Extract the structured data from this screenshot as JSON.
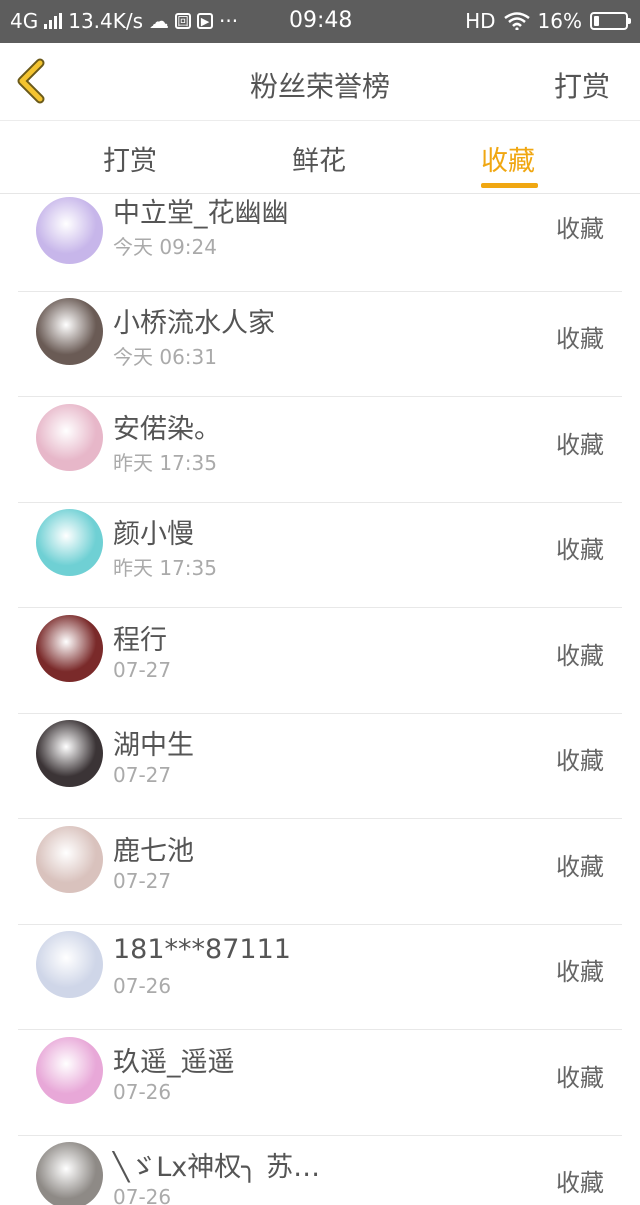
{
  "status_bar": {
    "network": "4G",
    "speed": "13.4K/s",
    "time": "09:48",
    "hd": "HD",
    "battery": "16%",
    "battery_level": 0.16,
    "dots": "···"
  },
  "header": {
    "title": "粉丝荣誉榜",
    "right_link": "打赏"
  },
  "tabs": [
    {
      "label": "打赏",
      "active": false
    },
    {
      "label": "鲜花",
      "active": false
    },
    {
      "label": "收藏",
      "active": true
    }
  ],
  "fans": [
    {
      "name": "中立堂_花幽幽",
      "time": "今天 09:24",
      "action": "收藏",
      "avatar_color": "#c7b6ea"
    },
    {
      "name": "小桥流水人家",
      "time": "今天 06:31",
      "action": "收藏",
      "avatar_color": "#6a5b55"
    },
    {
      "name": "安偌染。",
      "time": "昨天 17:35",
      "action": "收藏",
      "avatar_color": "#e7b7c9"
    },
    {
      "name": "颜小慢",
      "time": "昨天 17:35",
      "action": "收藏",
      "avatar_color": "#6fd0d4"
    },
    {
      "name": "程行",
      "time": "07-27",
      "action": "收藏",
      "avatar_color": "#7a2a2a"
    },
    {
      "name": "湖中生",
      "time": "07-27",
      "action": "收藏",
      "avatar_color": "#3b3436"
    },
    {
      "name": "鹿七池",
      "time": "07-27",
      "action": "收藏",
      "avatar_color": "#d9c2bd"
    },
    {
      "name": "181***87111",
      "time": "07-26",
      "action": "收藏",
      "avatar_color": "#cfd6e8"
    },
    {
      "name": "玖遥_遥遥",
      "time": "07-26",
      "action": "收藏",
      "avatar_color": "#e8a8d8"
    },
    {
      "name": "╲ゞLx神权╮ 苏…",
      "time": "07-26",
      "action": "收藏",
      "avatar_color": "#8e8a86"
    }
  ]
}
